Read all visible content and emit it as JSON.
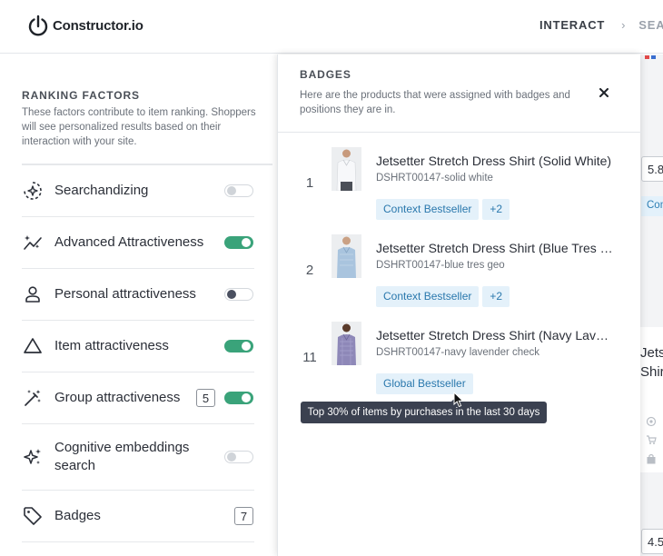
{
  "app": {
    "logo_text": "Constructor.io"
  },
  "nav": {
    "items": [
      "INTERACT",
      "SEAR"
    ]
  },
  "ranking_factors": {
    "title": "RANKING FACTORS",
    "description": "These factors contribute to item ranking. Shoppers will see personalized results based on their interaction with your site.",
    "items": [
      {
        "label": "Searchandizing",
        "icon": "searchandizing-icon",
        "enabled": false
      },
      {
        "label": "Advanced Attractiveness",
        "icon": "sparkle-trend-icon",
        "enabled": true
      },
      {
        "label": "Personal attractiveness",
        "icon": "person-icon",
        "enabled": false
      },
      {
        "label": "Item attractiveness",
        "icon": "triangle-icon",
        "enabled": true
      },
      {
        "label": "Group attractiveness",
        "icon": "magic-wand-icon",
        "enabled": true,
        "count": "5"
      },
      {
        "label": "Cognitive embeddings search",
        "icon": "sparkles-icon",
        "enabled": false
      },
      {
        "label": "Badges",
        "icon": "tag-icon",
        "count": "7"
      }
    ]
  },
  "badges_panel": {
    "title": "BADGES",
    "description": "Here are the products that were assigned with badges and positions they are in.",
    "close_icon": "close-icon",
    "products": [
      {
        "position": "1",
        "name": "Jetsetter Stretch Dress Shirt (Solid White)",
        "sku": "DSHRT00147-solid white",
        "badges": [
          "Context Bestseller",
          "+2"
        ],
        "shirt_color": "#f4f5f7"
      },
      {
        "position": "2",
        "name": "Jetsetter Stretch Dress Shirt (Blue Tres Geo)",
        "sku": "DSHRT00147-blue tres geo",
        "badges": [
          "Context Bestseller",
          "+2"
        ],
        "shirt_color": "#a9c4de"
      },
      {
        "position": "11",
        "name": "Jetsetter Stretch Dress Shirt (Navy Lavender Check)",
        "sku": "DSHRT00147-navy lavender check",
        "badges": [
          "Global Bestseller"
        ],
        "shirt_color": "#8e88b8"
      }
    ],
    "tooltip": "Top 30% of items by purchases in the last 30 days"
  },
  "background_peek": {
    "values": [
      "5.8",
      "4.5"
    ],
    "chip": "Con",
    "card_title_lines": [
      "Jets",
      "Shir"
    ]
  }
}
